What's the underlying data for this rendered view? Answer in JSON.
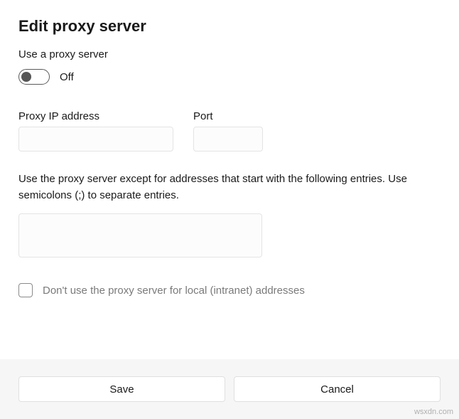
{
  "title": "Edit proxy server",
  "use_proxy_label": "Use a proxy server",
  "toggle": {
    "state_label": "Off",
    "on": false
  },
  "fields": {
    "ip": {
      "label": "Proxy IP address",
      "value": ""
    },
    "port": {
      "label": "Port",
      "value": ""
    }
  },
  "exceptions": {
    "description": "Use the proxy server except for addresses that start with the following entries. Use semicolons (;) to separate entries.",
    "value": ""
  },
  "local_bypass": {
    "checked": false,
    "label": "Don't use the proxy server for local (intranet) addresses"
  },
  "buttons": {
    "save": "Save",
    "cancel": "Cancel"
  },
  "watermark": "wsxdn.com"
}
